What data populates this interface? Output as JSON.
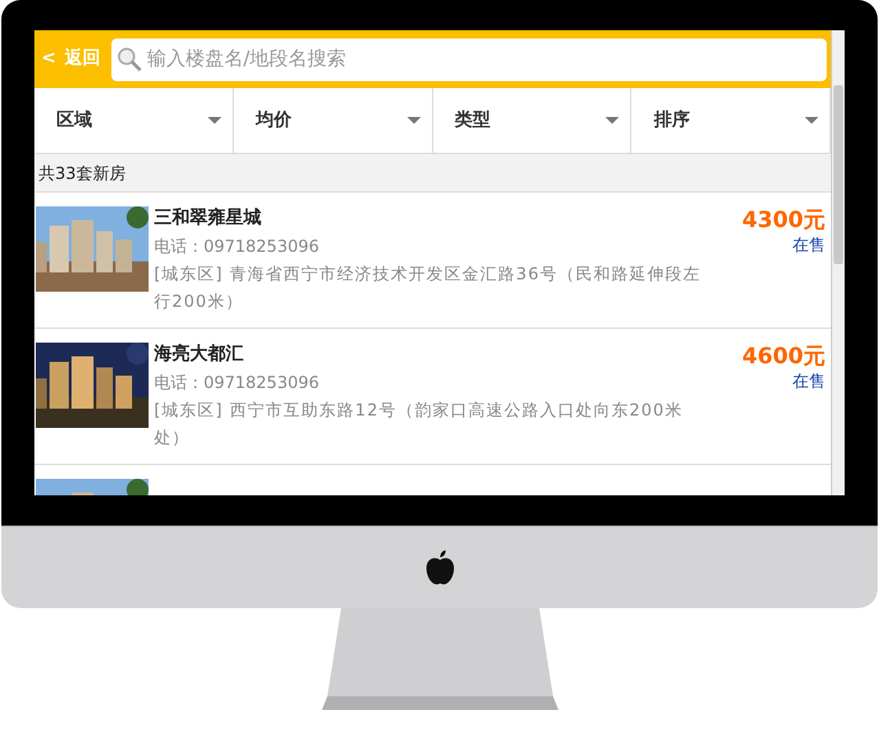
{
  "header": {
    "back": "<",
    "back_label": "返回",
    "search": {
      "placeholder": "输入楼盘名/地段名搜索"
    }
  },
  "filters": [
    "区域",
    "均价",
    "类型",
    "排序"
  ],
  "count": "共33套新房",
  "listings": [
    {
      "name": "三和翠雍星城",
      "phone": "电话：09718253096",
      "address": "[城东区] 青海省西宁市经济技术开发区金汇路36号（民和路延伸段左行200米）",
      "price": "4300元",
      "status": "在售",
      "picture": {
        "kind": "picture"
      }
    },
    {
      "name": "海亮大都汇",
      "phone": "电话：09718253096",
      "address": "[城东区] 西宁市互助东路12号（韵家口高速公路入口处向东200米处）",
      "price": "4600元",
      "status": "在售",
      "picture": {
        "kind": "picture"
      }
    },
    {
      "picture": {
        "kind": "picture"
      }
    }
  ]
}
